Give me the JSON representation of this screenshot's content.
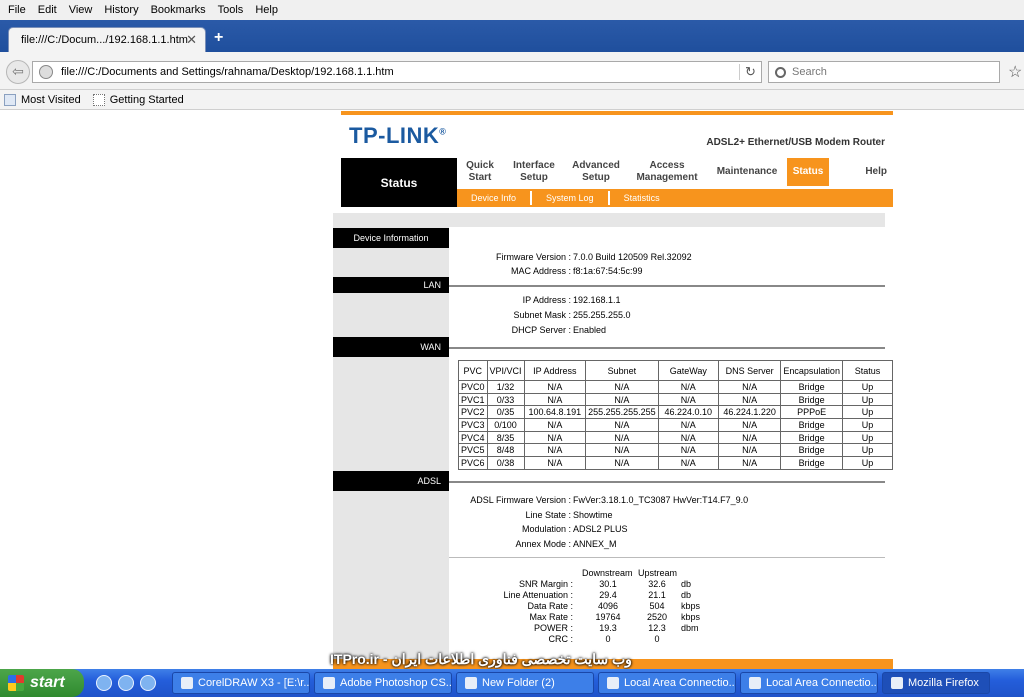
{
  "menu": [
    "File",
    "Edit",
    "View",
    "History",
    "Bookmarks",
    "Tools",
    "Help"
  ],
  "tab": {
    "title": "file:///C:/Docum.../192.168.1.1.htm"
  },
  "url": "file:///C:/Documents and Settings/rahnama/Desktop/192.168.1.1.htm",
  "search_placeholder": "Search",
  "bookmarks": [
    "Most Visited",
    "Getting Started"
  ],
  "router": {
    "brand": "TP-LINK",
    "reg": "®",
    "model": "ADSL2+ Ethernet/USB Modem Router",
    "current": "Status",
    "nav": [
      {
        "l1": "Quick",
        "l2": "Start"
      },
      {
        "l1": "Interface",
        "l2": "Setup"
      },
      {
        "l1": "Advanced",
        "l2": "Setup"
      },
      {
        "l1": "Access",
        "l2": "Management"
      },
      {
        "l1": "Maintenance",
        "l2": ""
      },
      {
        "l1": "Status",
        "l2": ""
      },
      {
        "l1": "Help",
        "l2": ""
      }
    ],
    "subnav": [
      "Device Info",
      "System Log",
      "Statistics"
    ],
    "sections": {
      "device": "Device Information",
      "lan": "LAN",
      "wan": "WAN",
      "adsl": "ADSL"
    },
    "device": [
      {
        "k": "Firmware Version :",
        "v": "7.0.0 Build 120509 Rel.32092"
      },
      {
        "k": "MAC Address :",
        "v": "f8:1a:67:54:5c:99"
      }
    ],
    "lan": [
      {
        "k": "IP Address :",
        "v": "192.168.1.1"
      },
      {
        "k": "Subnet Mask :",
        "v": "255.255.255.0"
      },
      {
        "k": "DHCP Server :",
        "v": "Enabled"
      }
    ],
    "wan": {
      "headers": [
        "PVC",
        "VPI/VCI",
        "IP Address",
        "Subnet",
        "GateWay",
        "DNS Server",
        "Encapsulation",
        "Status"
      ],
      "rows": [
        [
          "PVC0",
          "1/32",
          "N/A",
          "N/A",
          "N/A",
          "N/A",
          "Bridge",
          "Up"
        ],
        [
          "PVC1",
          "0/33",
          "N/A",
          "N/A",
          "N/A",
          "N/A",
          "Bridge",
          "Up"
        ],
        [
          "PVC2",
          "0/35",
          "100.64.8.191",
          "255.255.255.255",
          "46.224.0.10",
          "46.224.1.220",
          "PPPoE",
          "Up"
        ],
        [
          "PVC3",
          "0/100",
          "N/A",
          "N/A",
          "N/A",
          "N/A",
          "Bridge",
          "Up"
        ],
        [
          "PVC4",
          "8/35",
          "N/A",
          "N/A",
          "N/A",
          "N/A",
          "Bridge",
          "Up"
        ],
        [
          "PVC5",
          "8/48",
          "N/A",
          "N/A",
          "N/A",
          "N/A",
          "Bridge",
          "Up"
        ],
        [
          "PVC6",
          "0/38",
          "N/A",
          "N/A",
          "N/A",
          "N/A",
          "Bridge",
          "Up"
        ]
      ]
    },
    "adsl": [
      {
        "k": "ADSL Firmware Version :",
        "v": "FwVer:3.18.1.0_TC3087 HwVer:T14.F7_9.0"
      },
      {
        "k": "Line State :",
        "v": "Showtime"
      },
      {
        "k": "Modulation :",
        "v": "ADSL2 PLUS"
      },
      {
        "k": "Annex Mode :",
        "v": "ANNEX_M"
      }
    ],
    "stats": {
      "h_down": "Downstream",
      "h_up": "Upstream",
      "rows": [
        {
          "k": "SNR Margin :",
          "d": "30.1",
          "u": "32.6",
          "unit": "db"
        },
        {
          "k": "Line Attenuation :",
          "d": "29.4",
          "u": "21.1",
          "unit": "db"
        },
        {
          "k": "Data Rate :",
          "d": "4096",
          "u": "504",
          "unit": "kbps"
        },
        {
          "k": "Max Rate :",
          "d": "19764",
          "u": "2520",
          "unit": "kbps"
        },
        {
          "k": "POWER :",
          "d": "19.3",
          "u": "12.3",
          "unit": "dbm"
        },
        {
          "k": "CRC :",
          "d": "0",
          "u": "0",
          "unit": ""
        }
      ]
    }
  },
  "watermark": "ITPro.ir - وب سایت تخصصی فناوری اطلاعات ایران",
  "taskbar": {
    "start": "start",
    "items": [
      "CorelDRAW X3 - [E:\\r...",
      "Adobe Photoshop CS...",
      "New Folder (2)",
      "Local Area Connectio...",
      "Local Area Connectio...",
      "Mozilla Firefox"
    ]
  }
}
